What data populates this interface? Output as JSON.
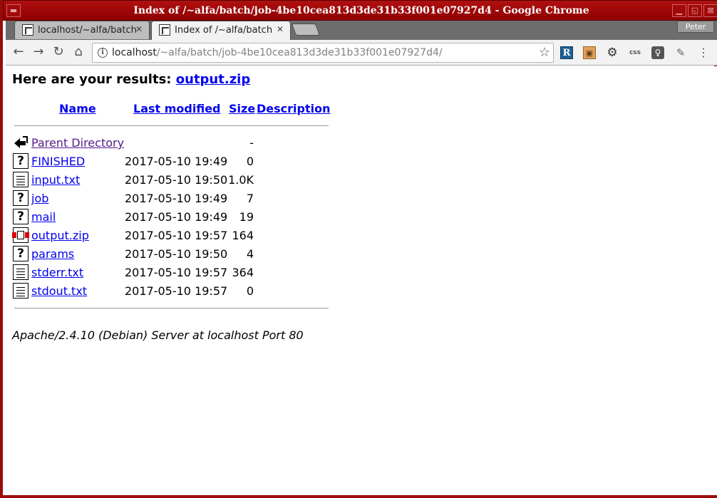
{
  "window": {
    "title": "Index of /~alfa/batch/job-4be10cea813d3de31b33f001e07927d4 - Google Chrome"
  },
  "tabs": [
    {
      "label": "localhost/~alfa/batch",
      "state": "inactive"
    },
    {
      "label": "Index of /~alfa/batch",
      "state": "active"
    }
  ],
  "profile": {
    "name": "Peter"
  },
  "address_bar": {
    "host": "localhost",
    "path": "/~alfa/batch/job-4be10cea813d3de31b33f001e07927d4/"
  },
  "extensions": [
    "R",
    "bag-icon",
    "gear-icon",
    "css",
    "lamp-icon",
    "feather-icon"
  ],
  "page": {
    "results_prefix": "Here are your results:",
    "results_link": "output.zip",
    "columns": {
      "name": "Name",
      "last_modified": "Last modified",
      "size": "Size",
      "description": "Description"
    },
    "rows": [
      {
        "icon": "back-icon",
        "name": "Parent Directory",
        "modified": "",
        "size": "-",
        "visited": true
      },
      {
        "icon": "unknown-file-icon",
        "name": "FINISHED",
        "modified": "2017-05-10 19:49",
        "size": "0"
      },
      {
        "icon": "text-file-icon",
        "name": "input.txt",
        "modified": "2017-05-10 19:50",
        "size": "1.0K"
      },
      {
        "icon": "unknown-file-icon",
        "name": "job",
        "modified": "2017-05-10 19:49",
        "size": "7"
      },
      {
        "icon": "unknown-file-icon",
        "name": "mail",
        "modified": "2017-05-10 19:49",
        "size": "19"
      },
      {
        "icon": "compressed-file-icon",
        "name": "output.zip",
        "modified": "2017-05-10 19:57",
        "size": "164"
      },
      {
        "icon": "unknown-file-icon",
        "name": "params",
        "modified": "2017-05-10 19:50",
        "size": "4"
      },
      {
        "icon": "text-file-icon",
        "name": "stderr.txt",
        "modified": "2017-05-10 19:57",
        "size": "364"
      },
      {
        "icon": "text-file-icon",
        "name": "stdout.txt",
        "modified": "2017-05-10 19:57",
        "size": "0"
      }
    ],
    "footer": "Apache/2.4.10 (Debian) Server at localhost Port 80"
  }
}
